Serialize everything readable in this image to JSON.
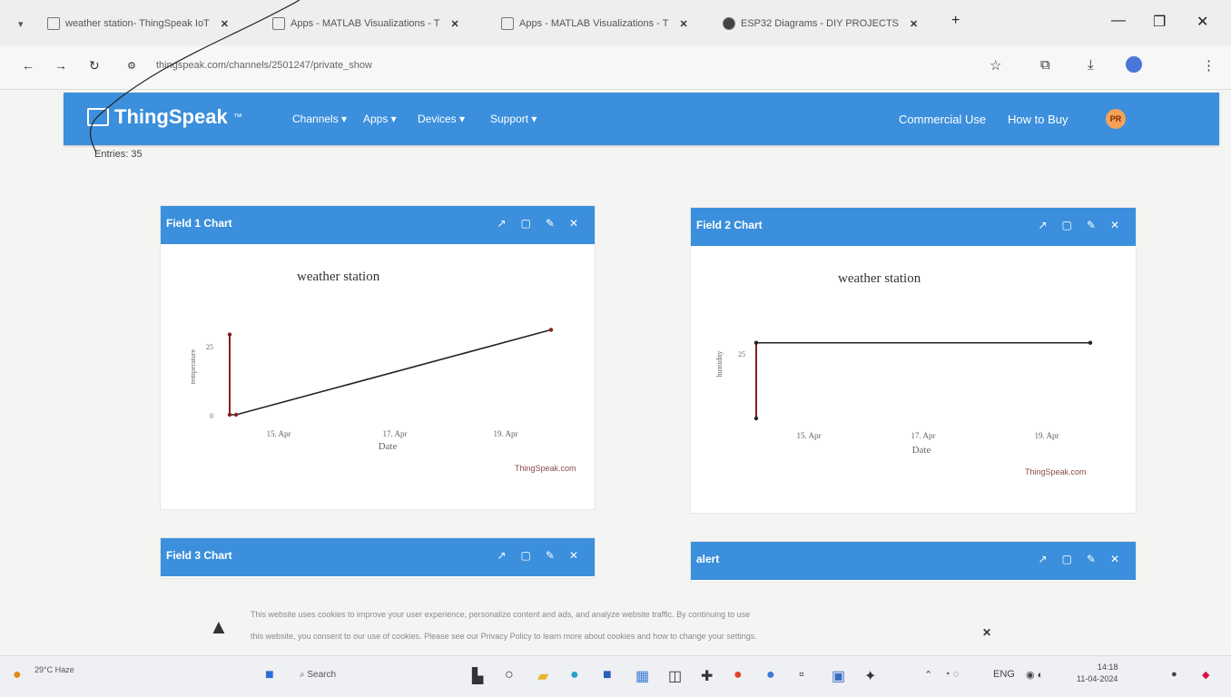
{
  "browser": {
    "tabs": [
      {
        "title": "weather station- ThingSpeak IoT"
      },
      {
        "title": "Apps - MATLAB Visualizations - T"
      },
      {
        "title": "Apps - MATLAB Visualizations - T"
      },
      {
        "title": "ESP32 Diagrams - DIY PROJECTS"
      }
    ],
    "url": "thingspeak.com/channels/2501247/private_show",
    "new_tab": "+",
    "window_controls": {
      "minimize": "—",
      "maximize": "❐",
      "close": "✕"
    }
  },
  "header": {
    "logo": "ThingSpeak",
    "logo_tm": "™",
    "menu": [
      "Channels ▾",
      "Apps ▾",
      "Devices ▾",
      "Support ▾"
    ],
    "right": [
      "Commercial Use",
      "How to Buy"
    ],
    "avatar_initials": "PR",
    "bg_color": "#3b8fdc"
  },
  "entries": "Entries: 35",
  "panels": [
    {
      "title": "Field 1 Chart",
      "chart_title": "weather station",
      "ylabel": "temperature",
      "xlabel": "Date",
      "xticks": [
        "15. Apr",
        "17. Apr",
        "19. Apr"
      ],
      "yticks": [
        "25",
        "0"
      ],
      "source": "ThingSpeak.com"
    },
    {
      "title": "Field 2 Chart",
      "chart_title": "weather station",
      "ylabel": "humidity",
      "xlabel": "Date",
      "xticks": [
        "15. Apr",
        "17. Apr",
        "19. Apr"
      ],
      "yticks": [
        "25"
      ],
      "source": "ThingSpeak.com"
    },
    {
      "title": "Field 3 Chart"
    },
    {
      "title": "alert"
    }
  ],
  "cookie": {
    "line1": "This website uses cookies to improve your user experience, personalize content and ads, and analyze website traffic. By continuing to use",
    "line2": "this website, you consent to our use of cookies. Please see our Privacy Policy to learn more about cookies and how to change your settings.",
    "close": "✕"
  },
  "taskbar": {
    "weather": "29°C Haze",
    "search": "Search",
    "time": "14:18",
    "date": "11-04-2024"
  },
  "chart_data": [
    {
      "type": "line",
      "title": "weather station",
      "xlabel": "Date",
      "ylabel": "temperature",
      "x": [
        "14. Apr",
        "14. Apr",
        "14. Apr",
        "20. Apr"
      ],
      "series": [
        {
          "values": [
            34,
            0,
            0,
            36
          ]
        }
      ],
      "xticks": [
        "15. Apr",
        "17. Apr",
        "19. Apr"
      ],
      "ylim": [
        0,
        40
      ]
    },
    {
      "type": "line",
      "title": "weather station",
      "xlabel": "Date",
      "ylabel": "humidity",
      "x": [
        "14. Apr",
        "14. Apr",
        "20. Apr"
      ],
      "series": [
        {
          "values": [
            0,
            31,
            31
          ]
        }
      ],
      "xticks": [
        "15. Apr",
        "17. Apr",
        "19. Apr"
      ],
      "ylim": [
        0,
        35
      ]
    }
  ]
}
